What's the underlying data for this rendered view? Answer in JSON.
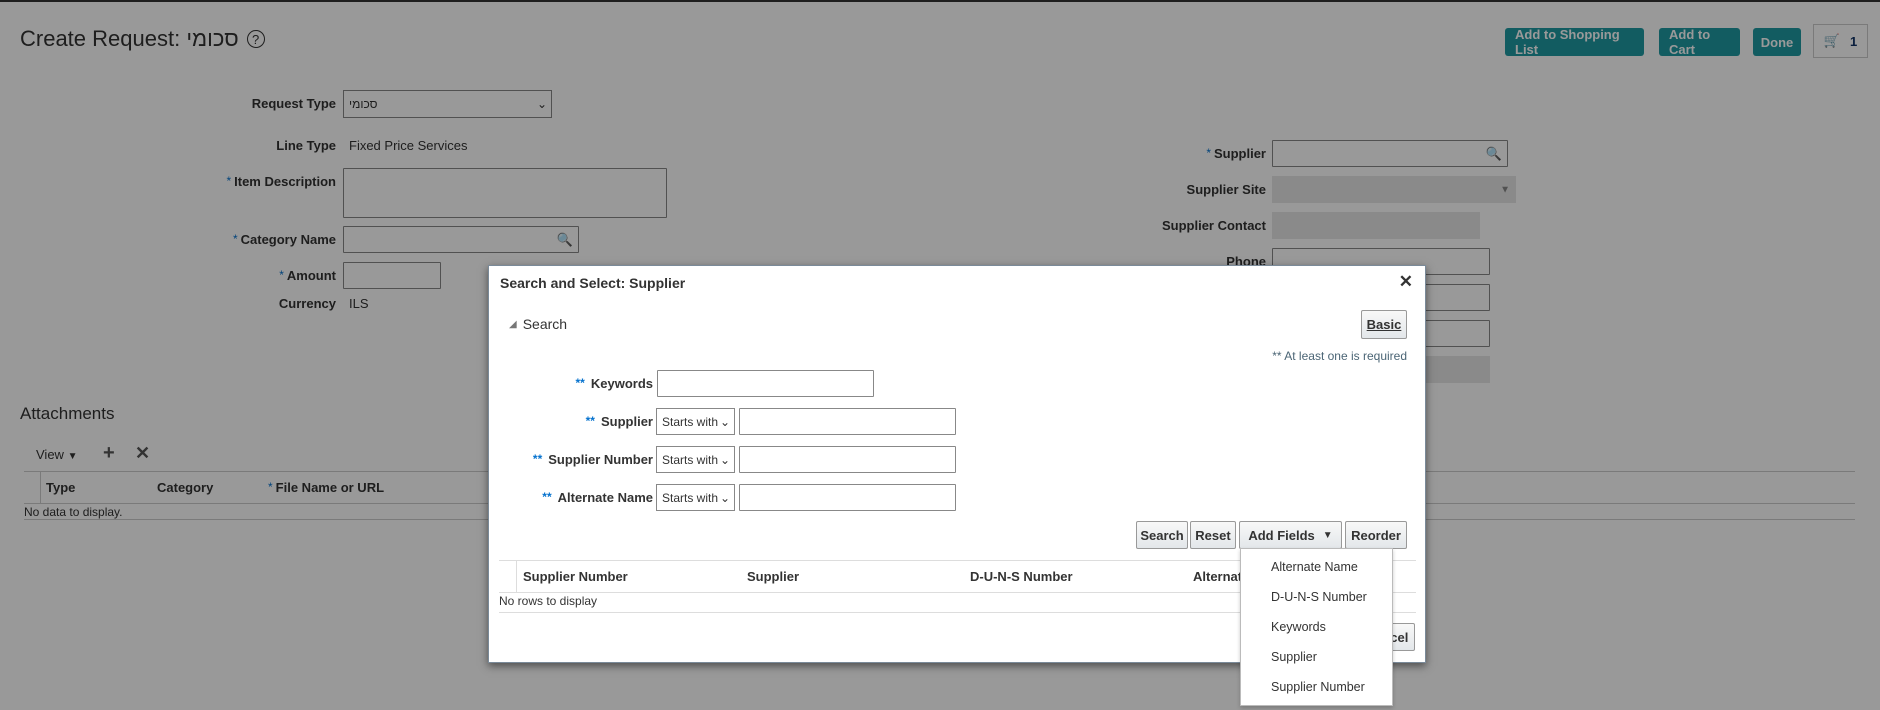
{
  "page": {
    "title": "Create Request: סכומי",
    "header_buttons": {
      "add_to_shopping_list": "Add to Shopping List",
      "add_to_cart": "Add to Cart",
      "done": "Done",
      "cart_count": "1"
    },
    "form": {
      "request_type_label": "Request Type",
      "request_type_value": "סכומי",
      "line_type_label": "Line Type",
      "line_type_value": "Fixed Price Services",
      "item_description_label": "Item Description",
      "category_name_label": "Category Name",
      "amount_label": "Amount",
      "currency_label": "Currency",
      "currency_value": "ILS",
      "supplier_label": "Supplier",
      "supplier_site_label": "Supplier Site",
      "supplier_contact_label": "Supplier Contact",
      "phone_label": "Phone",
      "required_mark": "*"
    },
    "attachments": {
      "title": "Attachments",
      "view_label": "View",
      "columns": [
        "Type",
        "Category",
        "File Name or URL"
      ],
      "empty": "No data to display."
    }
  },
  "dialog": {
    "title": "Search and Select: Supplier",
    "search_section": "Search",
    "basic_button": "Basic",
    "required_note": "** At least one is required",
    "req_mark": "**",
    "fields": [
      {
        "label": "Keywords"
      },
      {
        "label": "Supplier",
        "operator": "Starts with"
      },
      {
        "label": "Supplier Number",
        "operator": "Starts with"
      },
      {
        "label": "Alternate Name",
        "operator": "Starts with"
      }
    ],
    "buttons": {
      "search": "Search",
      "reset": "Reset",
      "add_fields": "Add Fields",
      "reorder": "Reorder",
      "cancel": "Cancel"
    },
    "columns": [
      "Supplier Number",
      "Supplier",
      "D-U-N-S Number",
      "Alternate Name"
    ],
    "empty": "No rows to display",
    "add_fields_menu": [
      "Alternate Name",
      "D-U-N-S Number",
      "Keywords",
      "Supplier",
      "Supplier Number"
    ]
  },
  "colors": {
    "accent": "#1e9aa2",
    "required": "#0572ce",
    "overlay": "rgba(0,0,0,0.4)"
  }
}
